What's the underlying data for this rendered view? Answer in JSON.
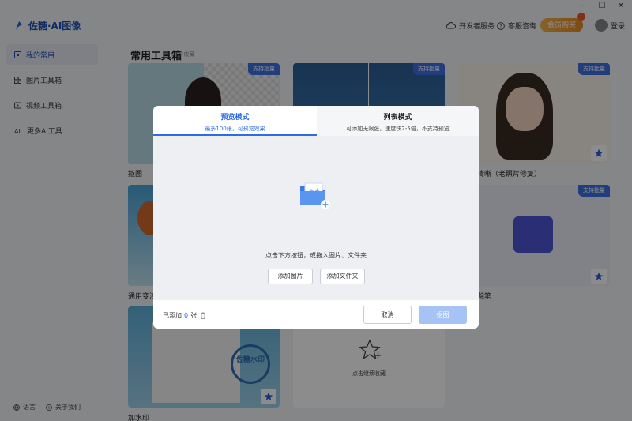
{
  "app": {
    "brand": "佐糖·AI图像"
  },
  "header": {
    "dev_service": "开发者服务",
    "support": "客服咨询",
    "vip": "会员购买",
    "login": "登录"
  },
  "sidebar": {
    "items": [
      {
        "label": "我的常用",
        "icon": "bookmark-icon"
      },
      {
        "label": "图片工具箱",
        "icon": "grid-icon"
      },
      {
        "label": "视频工具箱",
        "icon": "video-icon"
      },
      {
        "label": "更多AI工具",
        "icon": "ai-icon"
      }
    ],
    "language": "语言",
    "about": "关于我们"
  },
  "main": {
    "title": "常用工具箱",
    "subtitle": "7个收藏",
    "cards": [
      {
        "label": "抠图",
        "badge": "支持批量"
      },
      {
        "label": "",
        "badge": "支持批量"
      },
      {
        "label": "清晰（老照片修复）",
        "badge": "支持批量"
      },
      {
        "label": "通用变清",
        "badge": ""
      },
      {
        "label": "除笔",
        "badge": "支持批量"
      },
      {
        "label": "加水印",
        "badge": ""
      },
      {
        "label": "点击继续收藏",
        "badge": ""
      }
    ],
    "watermark_text": "佐糖水印"
  },
  "dialog": {
    "tabs": [
      {
        "title": "预览模式",
        "desc": "最多100张，可预览效果",
        "active": true
      },
      {
        "title": "列表模式",
        "desc": "可添加无限张，速度快2-5倍，不支持预览",
        "active": false
      }
    ],
    "drop_hint": "点击下方按钮，或拖入图片、文件夹",
    "add_image": "添加图片",
    "add_folder": "添加文件夹",
    "added_prefix": "已添加",
    "added_count": "0",
    "added_suffix": "张",
    "cancel": "取消",
    "next": "抠图"
  },
  "colors": {
    "accent": "#2e6be6",
    "badge": "#3e6fe0",
    "vip": "#e88a1e"
  }
}
